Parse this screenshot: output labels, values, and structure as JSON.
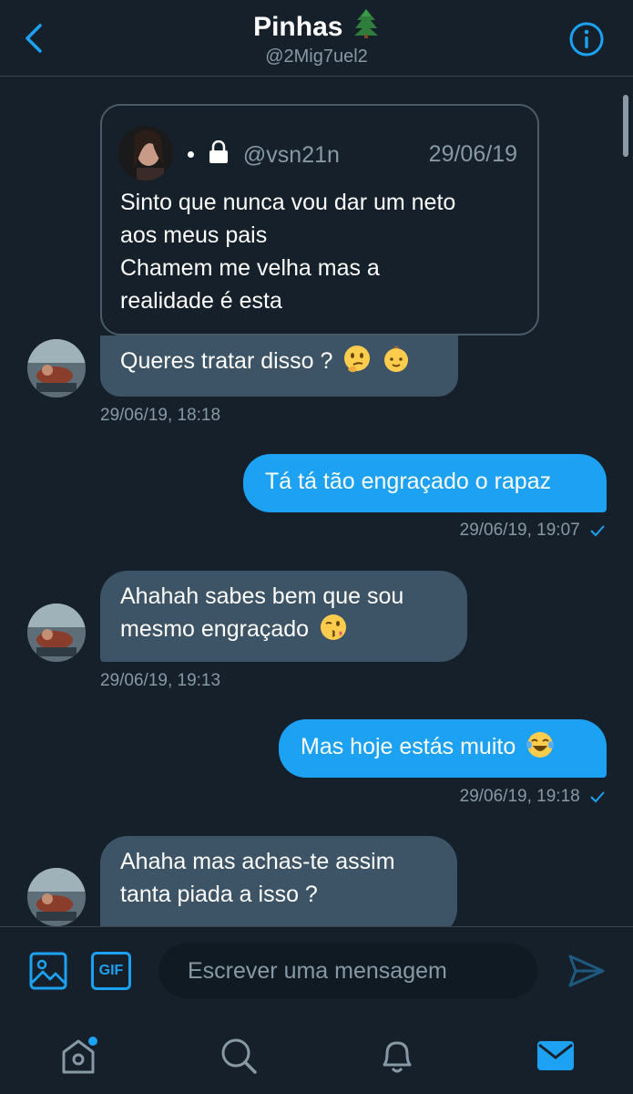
{
  "header": {
    "title": "Pinhas",
    "title_emoji": "tree-emoji",
    "handle": "@2Mig7uel2"
  },
  "quoted_tweet": {
    "handle": "@vsn21n",
    "date": "29/06/19",
    "lines": [
      "Sinto que nunca vou dar um neto",
      "aos meus pais",
      "Chamem me velha mas a",
      "realidade é esta"
    ]
  },
  "messages": [
    {
      "direction": "in",
      "text": "Queres tratar disso ?",
      "emojis": [
        "thinking-face-emoji",
        "baby-emoji"
      ],
      "timestamp": "29/06/19, 18:18"
    },
    {
      "direction": "out",
      "text": "Tá tá tão engraçado o rapaz",
      "timestamp": "29/06/19, 19:07",
      "read": true
    },
    {
      "direction": "in",
      "lines": [
        "Ahahah sabes bem que sou",
        "mesmo engraçado"
      ],
      "emojis": [
        "kissing-wink-emoji"
      ],
      "timestamp": "29/06/19, 19:13"
    },
    {
      "direction": "out",
      "text": "Mas hoje estás muito",
      "emojis": [
        "tears-of-joy-emoji"
      ],
      "timestamp": "29/06/19, 19:18",
      "read": true
    },
    {
      "direction": "in",
      "lines": [
        "Ahaha mas achas-te assim",
        "tanta piada a isso ?"
      ]
    }
  ],
  "composer": {
    "gif_label": "GIF",
    "placeholder": "Escrever uma mensagem"
  },
  "tabs": [
    {
      "icon": "home-icon",
      "notification_dot": true
    },
    {
      "icon": "search-icon"
    },
    {
      "icon": "bell-icon"
    },
    {
      "icon": "mail-icon",
      "active": true
    }
  ],
  "colors": {
    "background": "#15202b",
    "accent": "#1da1f2",
    "incoming_bubble": "#3d5466",
    "secondary_text": "#8899a6"
  }
}
